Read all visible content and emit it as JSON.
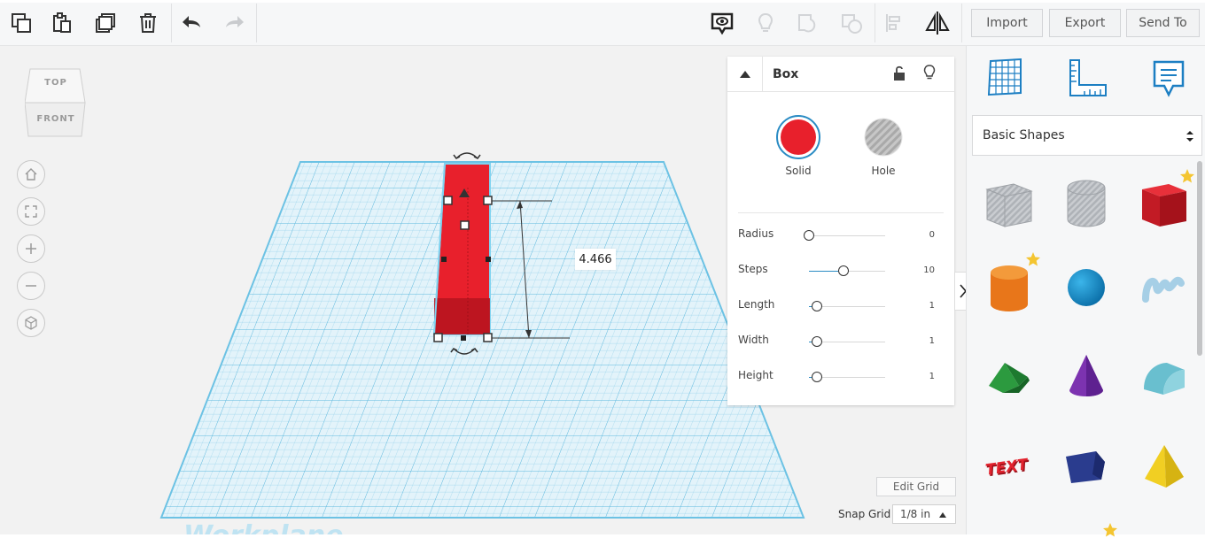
{
  "toolbar": {
    "left_tools": [
      "copy-icon",
      "paste-icon",
      "duplicate-icon",
      "delete-icon",
      "undo-icon",
      "redo-icon"
    ],
    "right_tools": [
      "notes-icon",
      "light-bulb-icon",
      "shapes-group-icon",
      "shapes-ungroup-icon",
      "align-icon",
      "mirror-icon"
    ],
    "import_label": "Import",
    "export_label": "Export",
    "sendto_label": "Send To"
  },
  "viewcube": {
    "top_label": "TOP",
    "front_label": "FRONT"
  },
  "canvas": {
    "workplane_label": "Workplane",
    "dimension_value": "4.466",
    "edit_grid_label": "Edit Grid",
    "snap_grid_label": "Snap Grid",
    "snap_grid_value": "1/8 in"
  },
  "inspector": {
    "title": "Box",
    "solid_label": "Solid",
    "hole_label": "Hole",
    "solid_color": "#e8202c",
    "properties": [
      {
        "label": "Radius",
        "value": "0",
        "level": 0.0
      },
      {
        "label": "Steps",
        "value": "10",
        "level": 0.45
      },
      {
        "label": "Length",
        "value": "1",
        "level": 0.1
      },
      {
        "label": "Width",
        "value": "1",
        "level": 0.1
      },
      {
        "label": "Height",
        "value": "1",
        "level": 0.1
      }
    ]
  },
  "sidebar": {
    "tabs": [
      "grid-icon",
      "ruler-icon",
      "notes-icon"
    ],
    "library_selected": "Basic Shapes",
    "shapes": [
      "box-hole",
      "cylinder-hole",
      "box",
      "cylinder",
      "sphere",
      "scribble",
      "roof",
      "cone",
      "round-roof",
      "text",
      "polygon",
      "pyramid"
    ]
  },
  "colors": {
    "accent": "#2b8cc4",
    "grid_blue": "#5bb8df",
    "box_red": "#e8202c"
  }
}
